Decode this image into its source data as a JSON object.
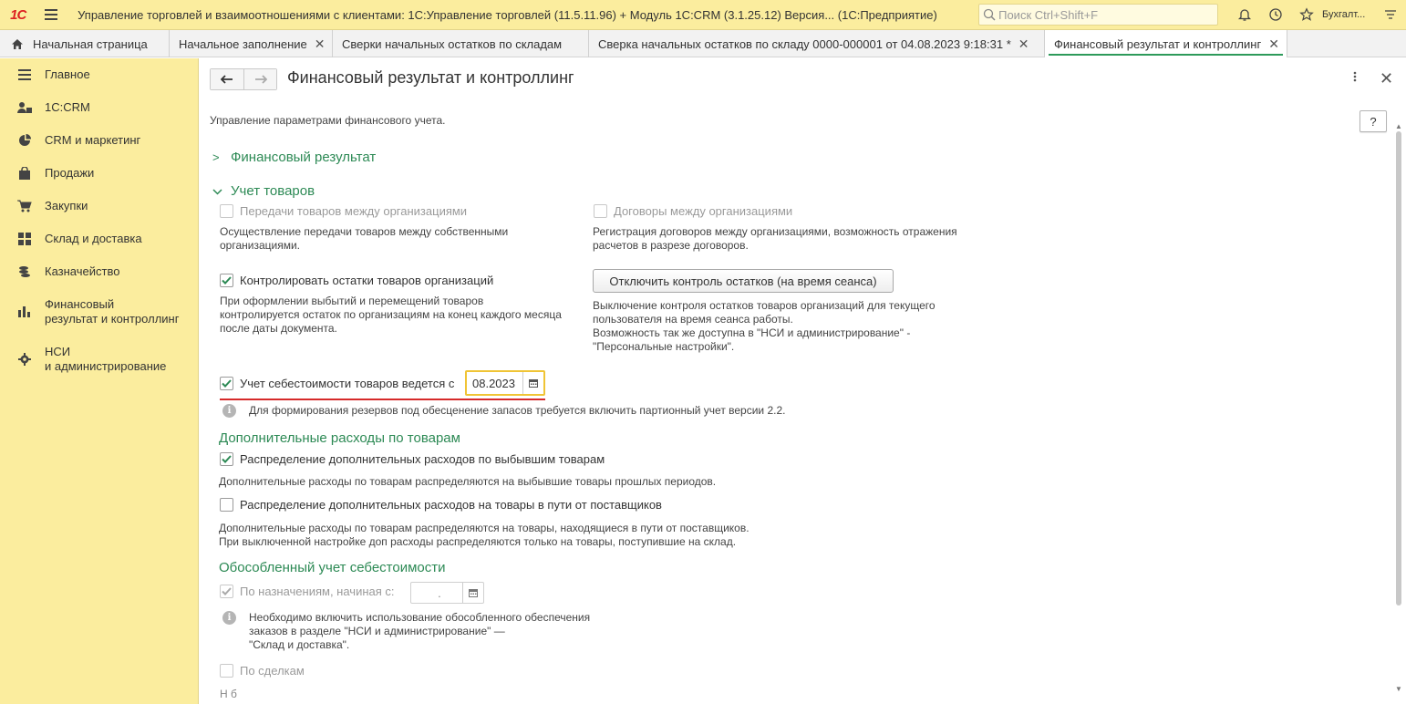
{
  "titlebar": {
    "logo": "1С",
    "app_title": "Управление торговлей и взаимоотношениями с клиентами: 1С:Управление торговлей (11.5.11.96) + Модуль 1С:CRM (3.1.25.12) Версия...  (1С:Предприятие)",
    "search_placeholder": "Поиск Ctrl+Shift+F",
    "user": "Бухгалт..."
  },
  "tabs": [
    {
      "label": "Начальная страница"
    },
    {
      "label": "Начальное заполнение"
    },
    {
      "label": "Сверки начальных остатков по складам"
    },
    {
      "label": "Сверка начальных остатков по складу 0000-000001 от 04.08.2023 9:18:31 *"
    },
    {
      "label": "Финансовый результат и контроллинг"
    }
  ],
  "sidebar": {
    "items": [
      {
        "label": "Главное",
        "icon": "menu-icon"
      },
      {
        "label": "1С:CRM",
        "icon": "users-icon"
      },
      {
        "label": "CRM и маркетинг",
        "icon": "pie-chart-icon"
      },
      {
        "label": "Продажи",
        "icon": "bag-icon"
      },
      {
        "label": "Закупки",
        "icon": "cart-icon"
      },
      {
        "label": "Склад и доставка",
        "icon": "grid-icon"
      },
      {
        "label": "Казначейство",
        "icon": "coins-icon"
      },
      {
        "label": "Финансовый\nрезультат и контроллинг",
        "icon": "bar-chart-icon"
      },
      {
        "label": "НСИ\nи администрирование",
        "icon": "gear-icon"
      }
    ]
  },
  "main": {
    "title": "Финансовый результат и контроллинг",
    "help": "?",
    "description": "Управление параметрами финансового учета.",
    "section_finres": "Финансовый результат",
    "section_goods": "Учет товаров",
    "cb_transfers": "Передачи товаров между организациями",
    "cb_transfers_desc": "Осуществление передачи товаров между собственными организациями.",
    "cb_contracts": "Договоры между организациями",
    "cb_contracts_desc": "Регистрация договоров между организациями, возможность отражения расчетов  в разрезе договоров.",
    "cb_control": "Контролировать остатки товаров организаций",
    "cb_control_desc": "При оформлении выбытий и перемещений товаров контролируется остаток по организациям на конец каждого месяца после даты документа.",
    "btn_disable_control": "Отключить контроль остатков (на время сеанса)",
    "btn_disable_desc": "Выключение контроля остатков товаров организаций для текущего пользователя на время сеанса работы.\n Возможность так же доступна в \"НСИ и администрирование\" - \"Персональные настройки\".",
    "cb_cost": "Учет себестоимости товаров ведется с",
    "cost_date": "08.2023",
    "info_reserves": "Для формирования резервов под обесценение запасов требуется включить партионный учет версии 2.2.",
    "sub_extra": "Дополнительные расходы по товарам",
    "cb_extra_out": "Распределение дополнительных расходов по выбывшим товарам",
    "cb_extra_out_desc": "Дополнительные расходы по товарам распределяются на выбывшие товары прошлых периодов.",
    "cb_extra_transit": "Распределение дополнительных расходов на товары в пути от поставщиков",
    "cb_extra_transit_desc": "Дополнительные расходы по товарам распределяются на товары, находящиеся в пути от поставщиков.\nПри выключенной настройке доп расходы распределяются только на товары, поступившие на склад.",
    "sub_separate": "Обособленный учет себестоимости",
    "cb_by_purpose": "По назначениям, начиная с:",
    "purpose_date": ".",
    "info_separate": "Необходимо включить использование обособленного обеспечения заказов в разделе \"НСИ и администрирование\" —\n\"Склад и доставка\".",
    "cb_by_deals": "По сделкам",
    "cut_text": "Н                      б"
  },
  "colors": {
    "accent_green": "#2d8a55",
    "sidebar_bg": "#fbed9e",
    "highlight_yellow": "#f0c435",
    "underline_red": "#d62a2a"
  }
}
